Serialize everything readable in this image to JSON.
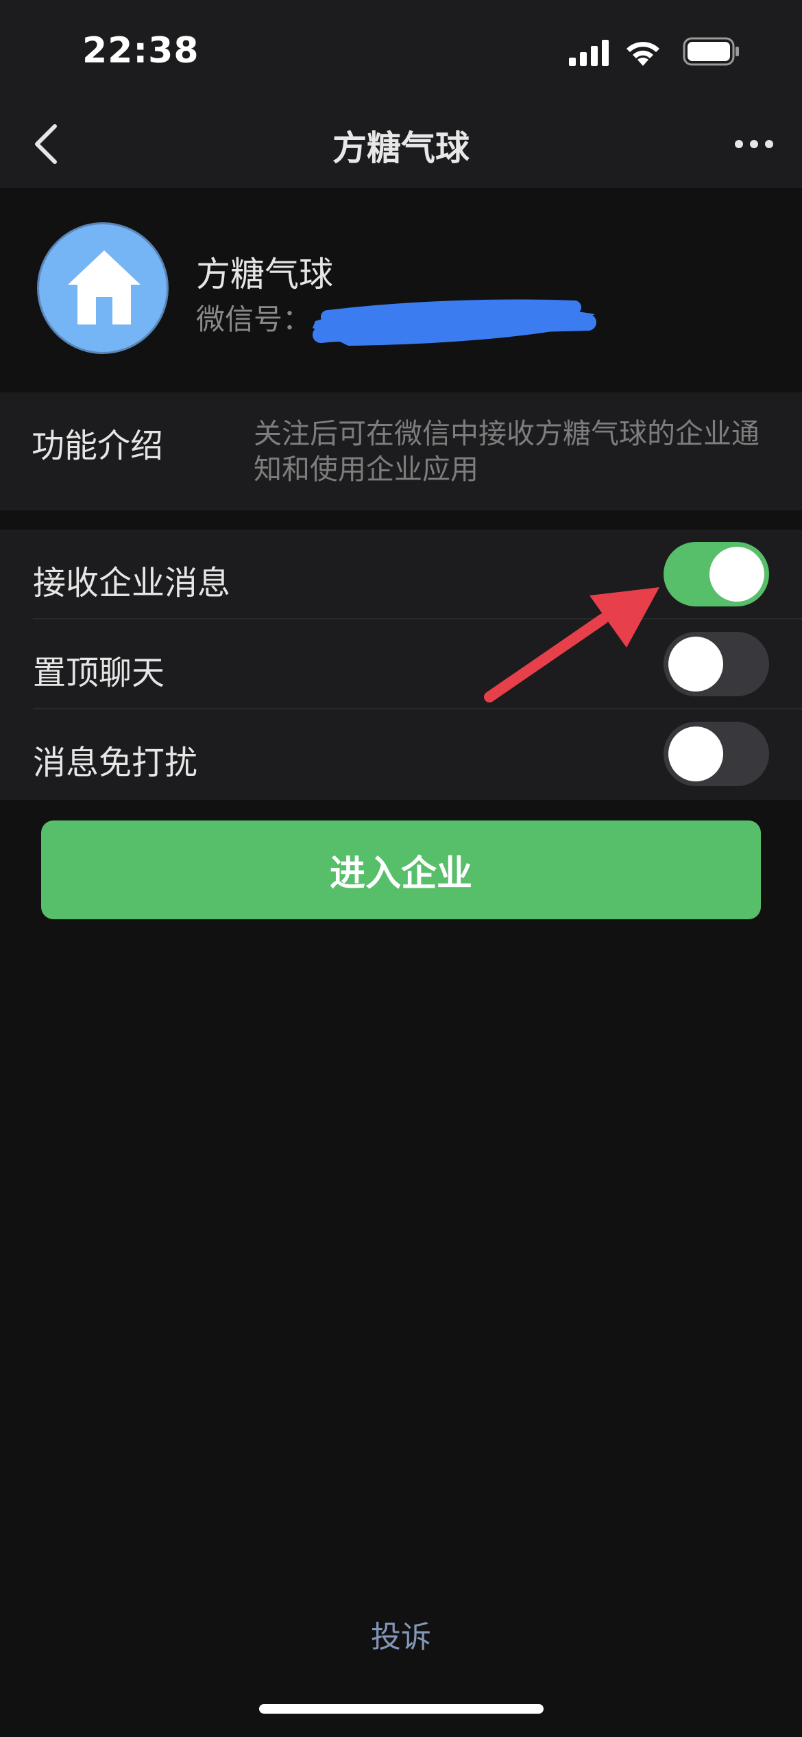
{
  "status_bar": {
    "time": "22:38"
  },
  "nav": {
    "title": "方糖气球"
  },
  "profile": {
    "name": "方糖气球",
    "id_label": "微信号："
  },
  "intro": {
    "label": "功能介绍",
    "description": "关注后可在微信中接收方糖气球的企业通知和使用企业应用"
  },
  "settings": [
    {
      "label": "接收企业消息",
      "enabled": true
    },
    {
      "label": "置顶聊天",
      "enabled": false
    },
    {
      "label": "消息免打扰",
      "enabled": false
    }
  ],
  "enter_button": {
    "label": "进入企业"
  },
  "footer": {
    "complaint": "投诉"
  },
  "colors": {
    "accent_green": "#57be6a",
    "avatar_blue": "#75b4f5",
    "annotation_red": "#e8404a",
    "redaction_blue": "#3b7df0"
  },
  "icons": [
    "signal-icon",
    "wifi-icon",
    "battery-icon",
    "back-chevron-icon",
    "more-icon",
    "house-icon",
    "annotation-arrow-icon"
  ]
}
